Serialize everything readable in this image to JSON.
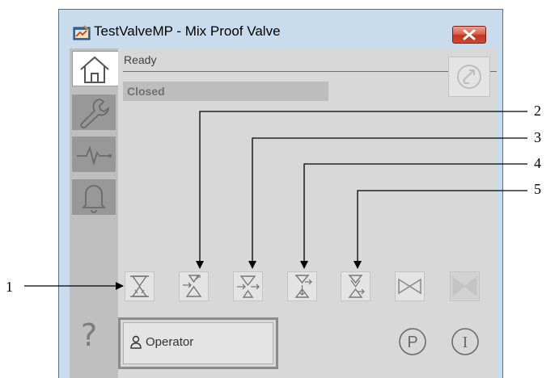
{
  "window": {
    "title": "TestValveMP - Mix Proof Valve",
    "close_icon": "close-x-icon",
    "app_icon": "faceplate-app-icon"
  },
  "nav": {
    "items": [
      {
        "name": "home",
        "icon": "home-icon",
        "selected": true
      },
      {
        "name": "maintenance",
        "icon": "wrench-icon",
        "selected": false
      },
      {
        "name": "trends",
        "icon": "trend-pulse-icon",
        "selected": false
      },
      {
        "name": "alarms",
        "icon": "bell-icon",
        "selected": false
      }
    ]
  },
  "status": {
    "text": "Ready",
    "state": "Closed"
  },
  "valve_buttons": [
    {
      "id": "1",
      "icon": "close-valve-icon"
    },
    {
      "id": "2",
      "icon": "lift-upper-seat-icon"
    },
    {
      "id": "3",
      "icon": "lift-lower-seat-icon"
    },
    {
      "id": "4",
      "icon": "pulse-upper-seat-icon"
    },
    {
      "id": "5",
      "icon": "pulse-lower-seat-icon"
    },
    {
      "id": "6",
      "icon": "open-valve-icon"
    },
    {
      "id": "7",
      "icon": "valve-disabled-icon"
    }
  ],
  "footer": {
    "help": "?",
    "operator_label": "Operator",
    "program_label": "P",
    "internal_label": "I"
  },
  "callouts": {
    "labels": [
      "1",
      "2",
      "3",
      "4",
      "5"
    ]
  },
  "colors": {
    "window_frame": "#c9dcee",
    "panel_background": "#d8d8d8",
    "close_button": "#c2331d",
    "nav_unselected": "#989898"
  }
}
